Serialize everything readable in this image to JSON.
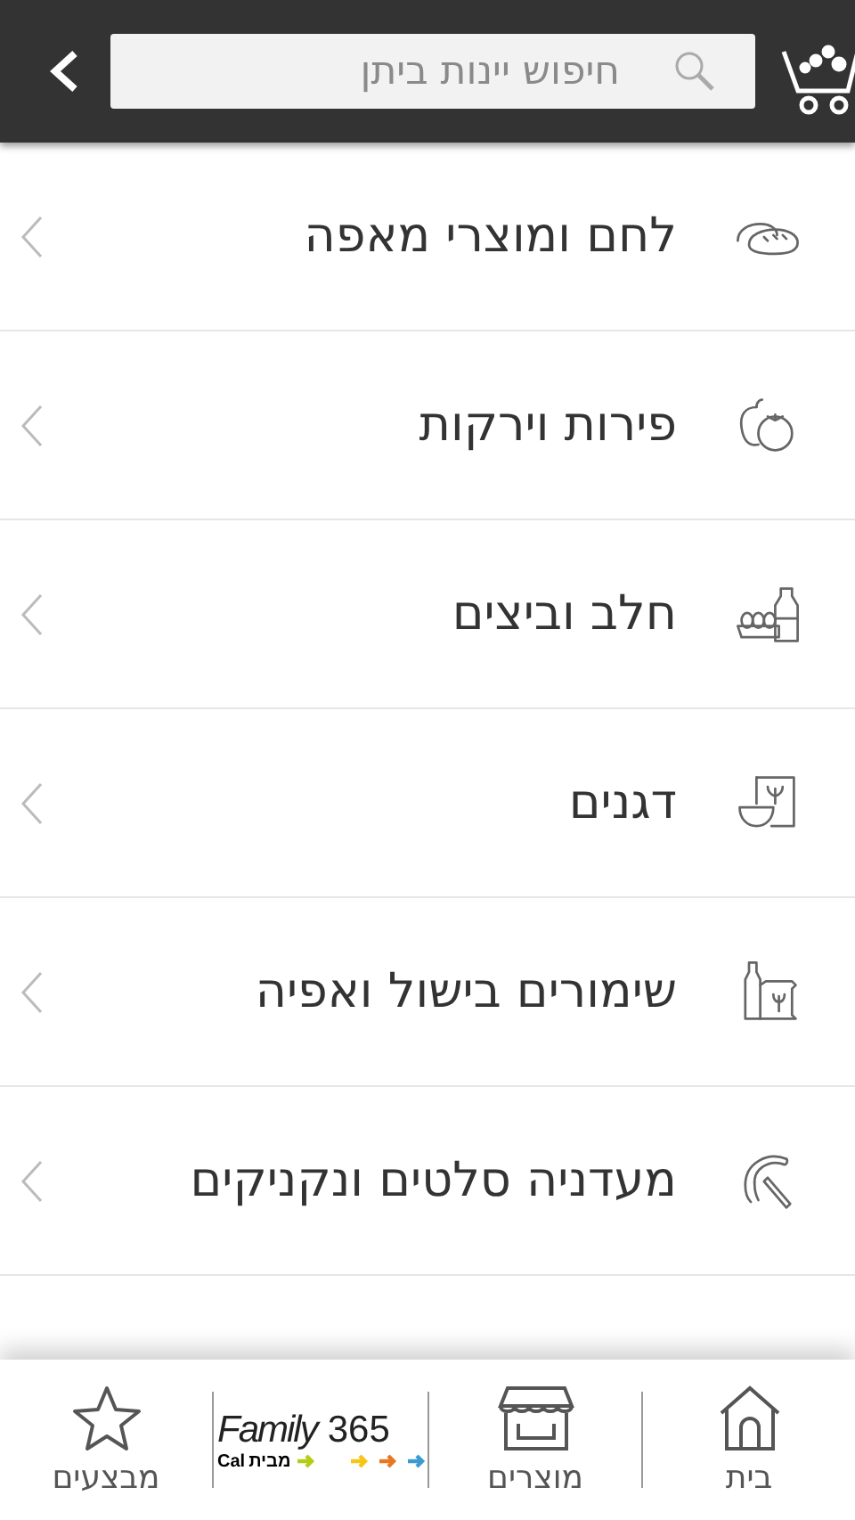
{
  "header": {
    "search": {
      "placeholder": "חיפוש יינות ביתן"
    }
  },
  "categories": [
    {
      "title": "לחם ומוצרי מאפה"
    },
    {
      "title": "פירות וירקות"
    },
    {
      "title": "חלב וביצים"
    },
    {
      "title": "דגנים"
    },
    {
      "title": "שימורים בישול ואפיה"
    },
    {
      "title": "מעדניה סלטים ונקניקים"
    }
  ],
  "bottom_nav": {
    "home": {
      "label": "בית"
    },
    "products": {
      "label": "מוצרים"
    },
    "logo": {
      "brand": "Family",
      "number": "365",
      "tagline": "מבית",
      "partner": "Cal"
    },
    "deals": {
      "label": "מבצעים"
    }
  }
}
